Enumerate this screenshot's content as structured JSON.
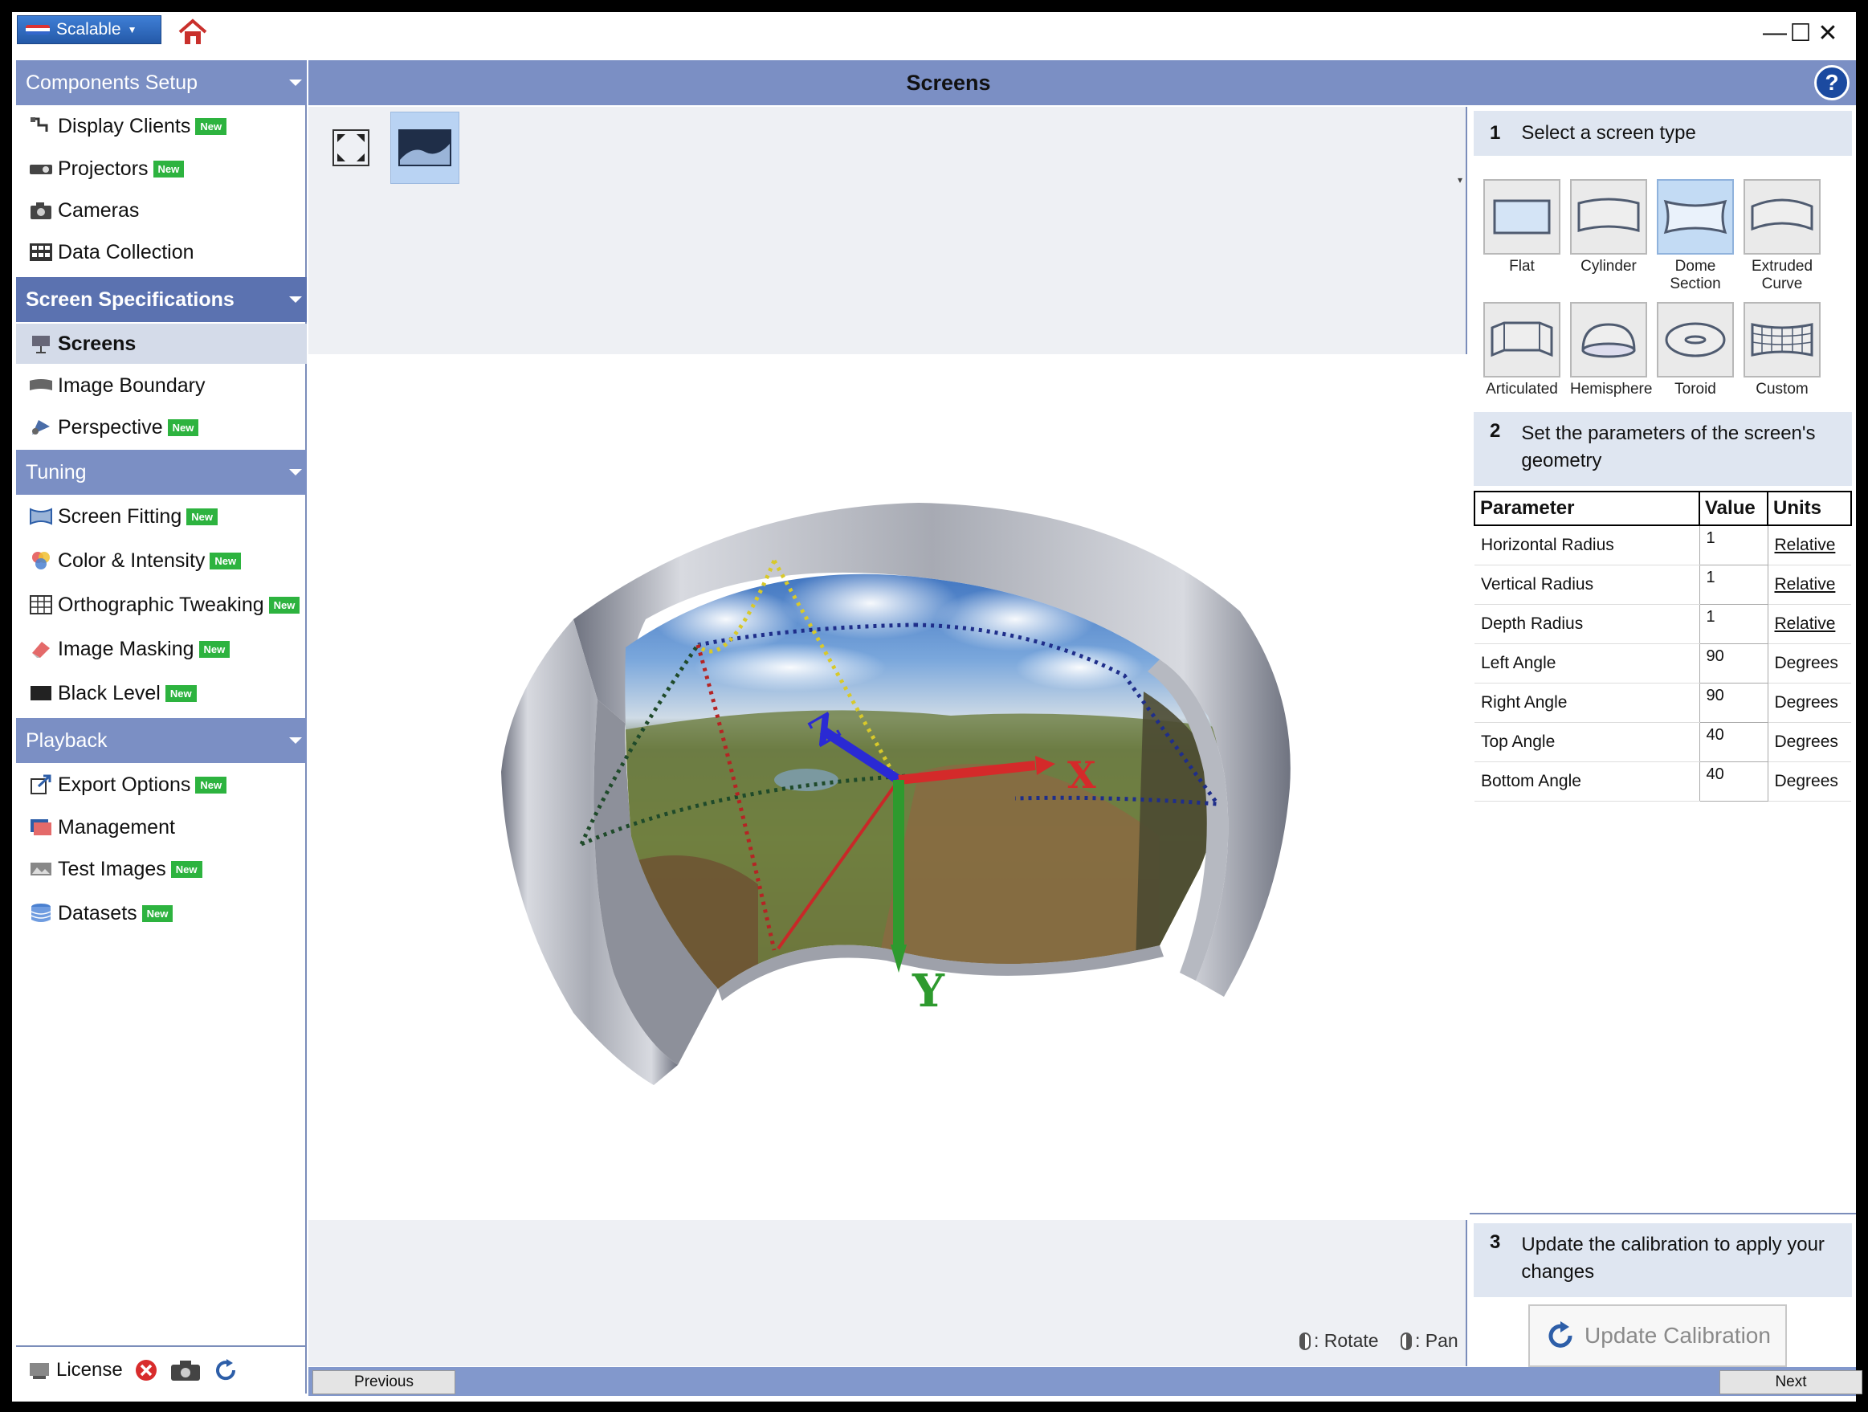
{
  "app": {
    "profile_label": "Scalable",
    "title": "Screens"
  },
  "window_controls": {
    "minimize": "—",
    "maximize": "☐",
    "close": "✕"
  },
  "sidebar": {
    "sections": [
      {
        "label": "Components Setup",
        "items": [
          {
            "label": "Display Clients",
            "new": "New",
            "icon": "display-clients-icon"
          },
          {
            "label": "Projectors",
            "new": "New",
            "icon": "projector-icon"
          },
          {
            "label": "Cameras",
            "new": "",
            "icon": "camera-icon"
          },
          {
            "label": "Data Collection",
            "new": "",
            "icon": "data-collection-icon"
          }
        ]
      },
      {
        "label": "Screen Specifications",
        "items": [
          {
            "label": "Screens",
            "new": "",
            "icon": "screen-icon"
          },
          {
            "label": "Image Boundary",
            "new": "",
            "icon": "image-boundary-icon"
          },
          {
            "label": "Perspective",
            "new": "New",
            "icon": "perspective-icon"
          }
        ]
      },
      {
        "label": "Tuning",
        "items": [
          {
            "label": "Screen Fitting",
            "new": "New",
            "icon": "screen-fitting-icon"
          },
          {
            "label": "Color & Intensity",
            "new": "New",
            "icon": "color-intensity-icon"
          },
          {
            "label": "Orthographic Tweaking",
            "new": "New",
            "icon": "grid-icon"
          },
          {
            "label": "Image Masking",
            "new": "New",
            "icon": "eraser-icon"
          },
          {
            "label": "Black Level",
            "new": "New",
            "icon": "black-level-icon"
          }
        ]
      },
      {
        "label": "Playback",
        "items": [
          {
            "label": "Export Options",
            "new": "New",
            "icon": "export-icon"
          },
          {
            "label": "Management",
            "new": "",
            "icon": "management-icon"
          },
          {
            "label": "Test Images",
            "new": "New",
            "icon": "test-images-icon"
          },
          {
            "label": "Datasets",
            "new": "New",
            "icon": "database-icon"
          }
        ]
      }
    ],
    "footer": {
      "license": "License"
    }
  },
  "viewport": {
    "hint_rotate": ": Rotate",
    "hint_pan": ": Pan",
    "axes": {
      "x": "X",
      "y": "Y",
      "z": "Z"
    }
  },
  "right_panel": {
    "step1": {
      "num": "1",
      "label": "Select a screen type"
    },
    "screen_types": [
      "Flat",
      "Cylinder",
      "Dome Section",
      "Extruded Curve",
      "Articulated",
      "Hemisphere",
      "Toroid",
      "Custom"
    ],
    "selected_type": "Dome Section",
    "step2": {
      "num": "2",
      "label": "Set the parameters of the screen's geometry"
    },
    "table": {
      "headers": [
        "Parameter",
        "Value",
        "Units"
      ],
      "rows": [
        [
          "Horizontal Radius",
          "1",
          "Relative"
        ],
        [
          "Vertical Radius",
          "1",
          "Relative"
        ],
        [
          "Depth Radius",
          "1",
          "Relative"
        ],
        [
          "Left Angle",
          "90",
          "Degrees"
        ],
        [
          "Right Angle",
          "90",
          "Degrees"
        ],
        [
          "Top Angle",
          "40",
          "Degrees"
        ],
        [
          "Bottom Angle",
          "40",
          "Degrees"
        ]
      ]
    },
    "step3": {
      "num": "3",
      "label": "Update the calibration to apply your changes"
    },
    "update_button": "Update Calibration"
  },
  "bottom_bar": {
    "previous": "Previous",
    "next": "Next"
  },
  "colors": {
    "header": "#7b8fc4",
    "selected": "#d4dbe9",
    "badge": "#2db33f",
    "x_axis": "#d42a2a",
    "y_axis": "#2e9a2e",
    "z_axis": "#2a2ad4"
  }
}
